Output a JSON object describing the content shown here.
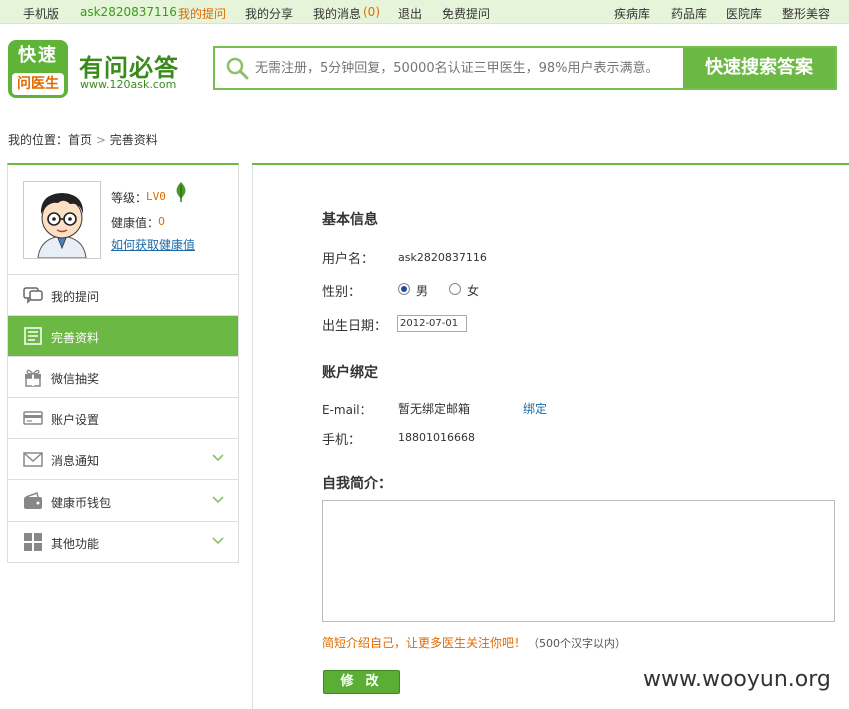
{
  "topbar": {
    "mobile": "手机版",
    "username": "ask2820837116",
    "my_questions": "我的提问",
    "my_shares": "我的分享",
    "my_messages": "我的消息",
    "message_count": "(0)",
    "logout": "退出",
    "free_ask": "免费提问",
    "disease_db": "疾病库",
    "drug_db": "药品库",
    "hospital_db": "医院库",
    "cosmetic": "整形美容"
  },
  "header": {
    "logo_top": "快速",
    "logo_bottom": "问医生",
    "brand_name": "有问必答",
    "brand_url": "www.120ask.com",
    "search_placeholder": "无需注册，5分钟回复，50000名认证三甲医生，98%用户表示满意。",
    "search_button": "快速搜索答案"
  },
  "breadcrumb": {
    "prefix": "我的位置：",
    "home": "首页",
    "sep": ">",
    "current": "完善资料"
  },
  "profile": {
    "level_label": "等级：",
    "level_value": "LV0",
    "health_label": "健康值：",
    "health_value": "0",
    "health_link": "如何获取健康值"
  },
  "menu": [
    {
      "label": "我的提问",
      "icon": "speech-bubble-icon"
    },
    {
      "label": "完善资料",
      "icon": "document-icon"
    },
    {
      "label": "微信抽奖",
      "icon": "gift-icon"
    },
    {
      "label": "账户设置",
      "icon": "card-icon"
    },
    {
      "label": "消息通知",
      "icon": "envelope-icon"
    },
    {
      "label": "健康币钱包",
      "icon": "wallet-icon"
    },
    {
      "label": "其他功能",
      "icon": "grid-icon"
    }
  ],
  "basic": {
    "title": "基本信息",
    "username_label": "用户名：",
    "username_value": "ask2820837116",
    "gender_label": "性别：",
    "gender_male": "男",
    "gender_female": "女",
    "birthday_label": "出生日期：",
    "birthday_value": "2012-07-01"
  },
  "account": {
    "title": "账户绑定",
    "email_label": "E-mail：",
    "email_value": "暂无绑定邮箱",
    "bind_link": "绑定",
    "phone_label": "手机：",
    "phone_value": "18801016668"
  },
  "bio": {
    "title": "自我简介：",
    "hint": "简短介绍自己，让更多医生关注你吧！",
    "limit": "（500个汉字以内）"
  },
  "submit_label": "修改",
  "watermark": "www.wooyun.org",
  "colors": {
    "accent_green": "#6cb844",
    "link_blue": "#1a6aa8",
    "warn_orange": "#e06a00"
  }
}
